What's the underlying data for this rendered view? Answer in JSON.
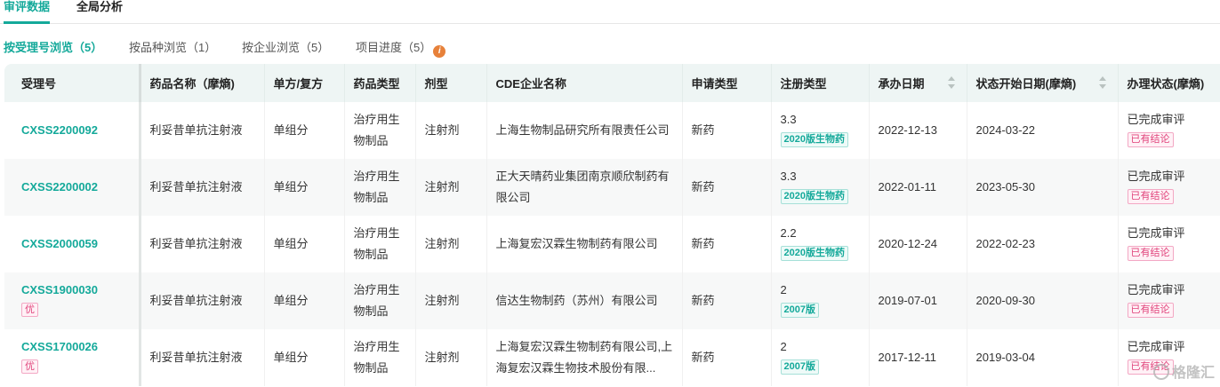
{
  "top_tabs": [
    {
      "label": "审评数据",
      "active": true
    },
    {
      "label": "全局分析",
      "active": false
    }
  ],
  "sub_tabs": [
    {
      "label": "按受理号浏览（5）",
      "active": true
    },
    {
      "label": "按品种浏览（1）",
      "active": false
    },
    {
      "label": "按企业浏览（5）",
      "active": false
    },
    {
      "label": "项目进度（5）",
      "active": false,
      "icon": "info-icon",
      "icon_glyph": "i"
    }
  ],
  "table": {
    "headers": [
      "受理号",
      "药品名称（摩熵)",
      "单方/复方",
      "药品类型",
      "剂型",
      "CDE企业名称",
      "申请类型",
      "注册类型",
      "承办日期",
      "状态开始日期(摩熵)",
      "办理状态(摩熵)"
    ],
    "sortable_columns": [
      "承办日期",
      "状态开始日期(摩熵)"
    ],
    "rows": [
      {
        "id": "CXSS2200092",
        "badge": "",
        "drug": "利妥昔单抗注射液",
        "compound": "单组分",
        "drug_type": "治疗用生物制品",
        "form": "注射剂",
        "company": "上海生物制品研究所有限责任公司",
        "apply_type": "新药",
        "reg_num": "3.3",
        "reg_tag": "2020版生物药",
        "date": "2022-12-13",
        "status_date": "2024-03-22",
        "status": "已完成审评",
        "status_tag": "已有结论"
      },
      {
        "id": "CXSS2200002",
        "badge": "",
        "drug": "利妥昔单抗注射液",
        "compound": "单组分",
        "drug_type": "治疗用生物制品",
        "form": "注射剂",
        "company": "正大天晴药业集团南京顺欣制药有限公司",
        "apply_type": "新药",
        "reg_num": "3.3",
        "reg_tag": "2020版生物药",
        "date": "2022-01-11",
        "status_date": "2023-05-30",
        "status": "已完成审评",
        "status_tag": "已有结论"
      },
      {
        "id": "CXSS2000059",
        "badge": "",
        "drug": "利妥昔单抗注射液",
        "compound": "单组分",
        "drug_type": "治疗用生物制品",
        "form": "注射剂",
        "company": "上海复宏汉霖生物制药有限公司",
        "apply_type": "新药",
        "reg_num": "2.2",
        "reg_tag": "2020版生物药",
        "date": "2020-12-24",
        "status_date": "2022-02-23",
        "status": "已完成审评",
        "status_tag": "已有结论"
      },
      {
        "id": "CXSS1900030",
        "badge": "优",
        "drug": "利妥昔单抗注射液",
        "compound": "单组分",
        "drug_type": "治疗用生物制品",
        "form": "注射剂",
        "company": "信达生物制药（苏州）有限公司",
        "apply_type": "新药",
        "reg_num": "2",
        "reg_tag": "2007版",
        "date": "2019-07-01",
        "status_date": "2020-09-30",
        "status": "已完成审评",
        "status_tag": "已有结论"
      },
      {
        "id": "CXSS1700026",
        "badge": "优",
        "drug": "利妥昔单抗注射液",
        "compound": "单组分",
        "drug_type": "治疗用生物制品",
        "form": "注射剂",
        "company": "上海复宏汉霖生物制药有限公司,上海复宏汉霖生物技术股份有限...",
        "apply_type": "新药",
        "reg_num": "2",
        "reg_tag": "2007版",
        "date": "2017-12-11",
        "status_date": "2019-03-04",
        "status": "已完成审评",
        "status_tag": "已有结论"
      }
    ]
  },
  "watermark": {
    "text": "格隆汇",
    "icon": "gelonghui-logo-icon"
  }
}
